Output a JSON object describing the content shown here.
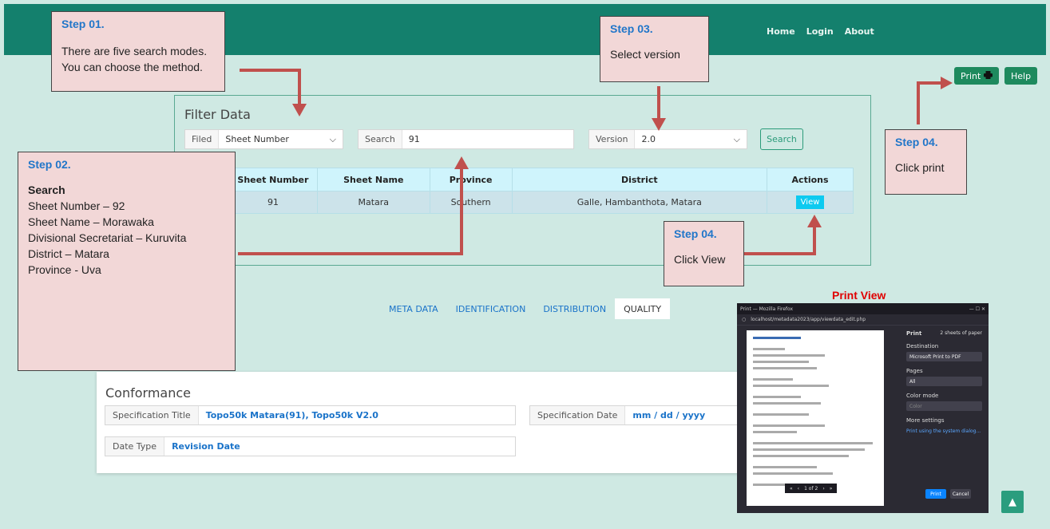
{
  "nav": {
    "items": [
      "Home",
      "Login",
      "About"
    ]
  },
  "toolbar": {
    "print_label": "Print",
    "help_label": "Help"
  },
  "filter": {
    "title": "Filter Data",
    "field_label": "Filed",
    "field_value": "Sheet Number",
    "search_label": "Search",
    "search_value": "91",
    "version_label": "Version",
    "version_value": "2.0",
    "search_button": "Search"
  },
  "table": {
    "headers": [
      "Sheet Number",
      "Sheet Name",
      "Province",
      "District",
      "Actions"
    ],
    "rows": [
      {
        "sheet_number": "91",
        "sheet_name": "Matara",
        "province": "Southern",
        "district": "Galle, Hambanthota, Matara",
        "action": "View"
      }
    ]
  },
  "tabs": [
    "META DATA",
    "IDENTIFICATION",
    "DISTRIBUTION",
    "QUALITY"
  ],
  "conformance": {
    "title": "Conformance",
    "spec_title_label": "Specification Title",
    "spec_title_value": "Topo50k Matara(91), Topo50k V2.0",
    "spec_date_label": "Specification Date",
    "spec_date_value": "mm / dd / yyyy",
    "date_type_label": "Date Type",
    "date_type_value": "Revision Date"
  },
  "notes": {
    "step1": {
      "heading": "Step 01.",
      "line1": "There are five search modes.",
      "line2": "You can choose the method."
    },
    "step2": {
      "heading": "Step 02.",
      "subheading": "Search",
      "lines": [
        "Sheet Number – 92",
        "Sheet Name – Morawaka",
        "Divisional Secretariat – Kuruvita",
        "District – Matara",
        "Province - Uva"
      ]
    },
    "step3": {
      "heading": "Step 03.",
      "text": "Select version"
    },
    "step4_print": {
      "heading": "Step 04.",
      "text": "Click print"
    },
    "step4_view": {
      "heading": "Step 04.",
      "text": "Click View"
    }
  },
  "print_view": {
    "label": "Print View",
    "window_title": "Print — Mozilla Firefox",
    "address": "localhost/metadata2023/app/viewdata_edit.php",
    "panel_title": "Print",
    "sheets": "2 sheets of paper",
    "destination_label": "Destination",
    "destination_value": "Microsoft Print to PDF",
    "pages_label": "Pages",
    "pages_value": "All",
    "color_label": "Color mode",
    "color_value": "Color",
    "more_settings": "More settings",
    "system_dialog": "Print using the system dialog...",
    "pager": "1 of 2",
    "print_button": "Print",
    "cancel_button": "Cancel"
  },
  "colors": {
    "header": "#14806d",
    "background": "#cfe9e3",
    "note_bg": "#f2d7d7",
    "arrow": "#c0504d",
    "accent_blue": "#2176c9"
  }
}
